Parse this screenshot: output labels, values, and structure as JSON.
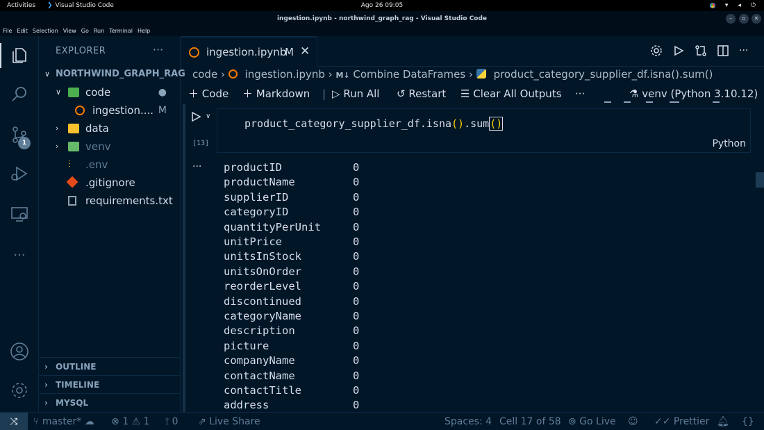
{
  "gnome": {
    "activities": "Activities",
    "app_name": "Visual Studio Code",
    "clock": "Ago 26  09:05"
  },
  "window": {
    "title": "ingestion.ipynb - northwind_graph_rag - Visual Studio Code"
  },
  "menu": [
    "File",
    "Edit",
    "Selection",
    "View",
    "Go",
    "Run",
    "Terminal",
    "Help"
  ],
  "activity_bar": {
    "scm_badge": "1"
  },
  "sidebar": {
    "header": "EXPLORER",
    "more": "···",
    "root": "NORTHWIND_GRAPH_RAG",
    "items": [
      {
        "label": "code",
        "git": "●"
      },
      {
        "label": "ingestion.ipynb",
        "display": "ingestion....",
        "git": "M"
      },
      {
        "label": "data"
      },
      {
        "label": "venv"
      },
      {
        "label": ".env"
      },
      {
        "label": ".gitignore"
      },
      {
        "label": "requirements.txt"
      }
    ],
    "sections": [
      "OUTLINE",
      "TIMELINE",
      "MYSQL"
    ]
  },
  "tab": {
    "label": "ingestion.ipynb",
    "modified": "M",
    "close": "✕"
  },
  "breadcrumb": {
    "folder": "code",
    "file": "ingestion.ipynb",
    "md_marker": "M↓",
    "section": "Combine DataFrames",
    "cell": "product_category_supplier_df.isna().sum()"
  },
  "toolbar": {
    "code": "Code",
    "markdown": "Markdown",
    "run_all": "Run All",
    "restart": "Restart",
    "clear": "Clear All Outputs",
    "more": "···",
    "kernel": "venv (Python 3.10.12)"
  },
  "cell": {
    "code_prefix": "product_category_supplier_df.isna",
    "p1": "()",
    "dot_sum": ".sum",
    "p2": "()",
    "exec_count": "[13]",
    "language": "Python",
    "output_more": "···"
  },
  "output": [
    {
      "name": "productID",
      "value": "0"
    },
    {
      "name": "productName",
      "value": "0"
    },
    {
      "name": "supplierID",
      "value": "0"
    },
    {
      "name": "categoryID",
      "value": "0"
    },
    {
      "name": "quantityPerUnit",
      "value": "0"
    },
    {
      "name": "unitPrice",
      "value": "0"
    },
    {
      "name": "unitsInStock",
      "value": "0"
    },
    {
      "name": "unitsOnOrder",
      "value": "0"
    },
    {
      "name": "reorderLevel",
      "value": "0"
    },
    {
      "name": "discontinued",
      "value": "0"
    },
    {
      "name": "categoryName",
      "value": "0"
    },
    {
      "name": "description",
      "value": "0"
    },
    {
      "name": "picture",
      "value": "0"
    },
    {
      "name": "companyName",
      "value": "0"
    },
    {
      "name": "contactName",
      "value": "0"
    },
    {
      "name": "contactTitle",
      "value": "0"
    },
    {
      "name": "address",
      "value": "0"
    }
  ],
  "status": {
    "branch": "master*",
    "errors": "1",
    "warnings": "1",
    "ports": "0",
    "live_share": "Live Share",
    "spaces": "Spaces: 4",
    "cell": "Cell 17 of 58",
    "go_live": "Go Live",
    "prettier": "Prettier"
  },
  "colors": {
    "background": "#011627",
    "accent_yellow": "#ffd700",
    "muted": "#5f7e97",
    "text": "#d6deeb"
  }
}
